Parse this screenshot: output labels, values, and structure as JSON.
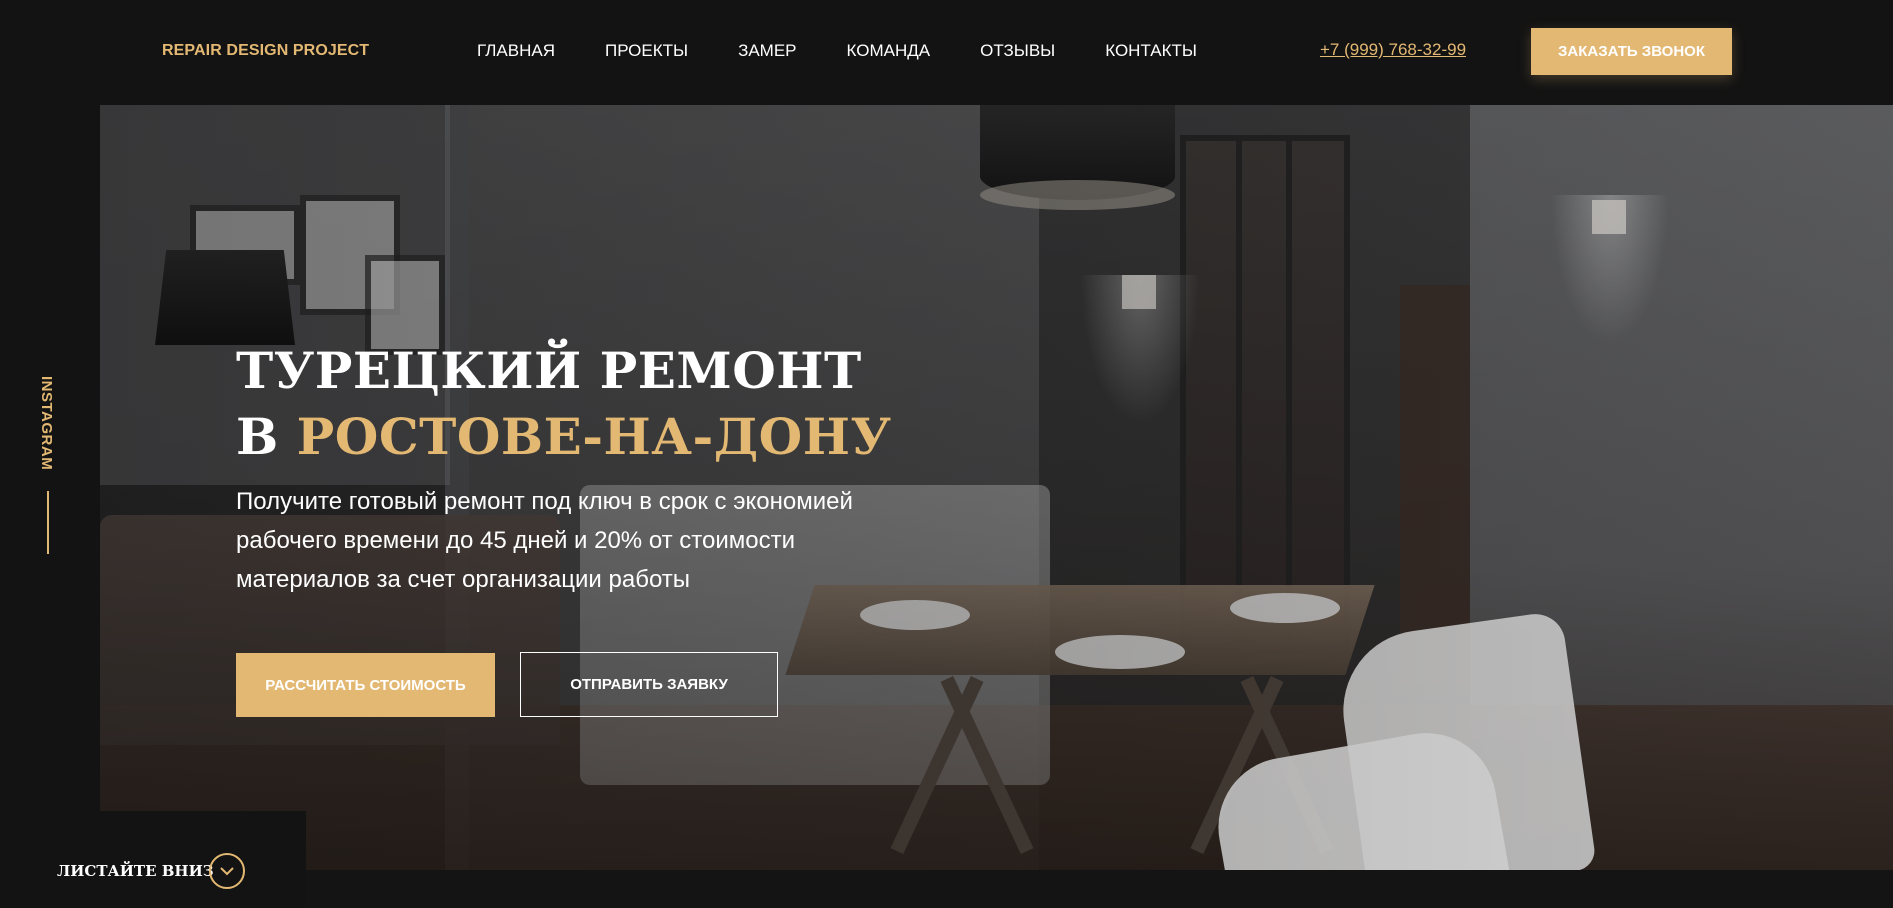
{
  "header": {
    "logo": "REPAIR DESIGN PROJECT",
    "nav": [
      {
        "label": "ГЛАВНАЯ"
      },
      {
        "label": "ПРОЕКТЫ"
      },
      {
        "label": "ЗАМЕР"
      },
      {
        "label": "КОМАНДА"
      },
      {
        "label": "ОТЗЫВЫ"
      },
      {
        "label": "КОНТАКТЫ"
      }
    ],
    "phone": "+7 (999) 768-32-99",
    "call_button": "ЗАКАЗАТЬ ЗВОНОК"
  },
  "sidebar": {
    "social_label": "INSTAGRAM"
  },
  "hero": {
    "title_line1": "ТУРЕЦКИЙ РЕМОНТ",
    "title_line2_prefix": "В ",
    "title_line2_accent": "РОСТОВЕ-НА-ДОНУ",
    "subtitle_line1": "Получите готовый ремонт под ключ в срок с экономией",
    "subtitle_line2": "рабочего времени до 45 дней и 20% от стоимости",
    "subtitle_line3": "материалов за счет организации работы",
    "primary_button": "РАССЧИТАТЬ СТОИМОСТЬ",
    "secondary_button": "ОТПРАВИТЬ ЗАЯВКУ"
  },
  "scroll": {
    "label": "ЛИСТАЙТЕ ВНИЗ",
    "icon": "chevron-down-icon"
  },
  "colors": {
    "background": "#131313",
    "accent": "#e3b873",
    "text": "#ffffff"
  }
}
